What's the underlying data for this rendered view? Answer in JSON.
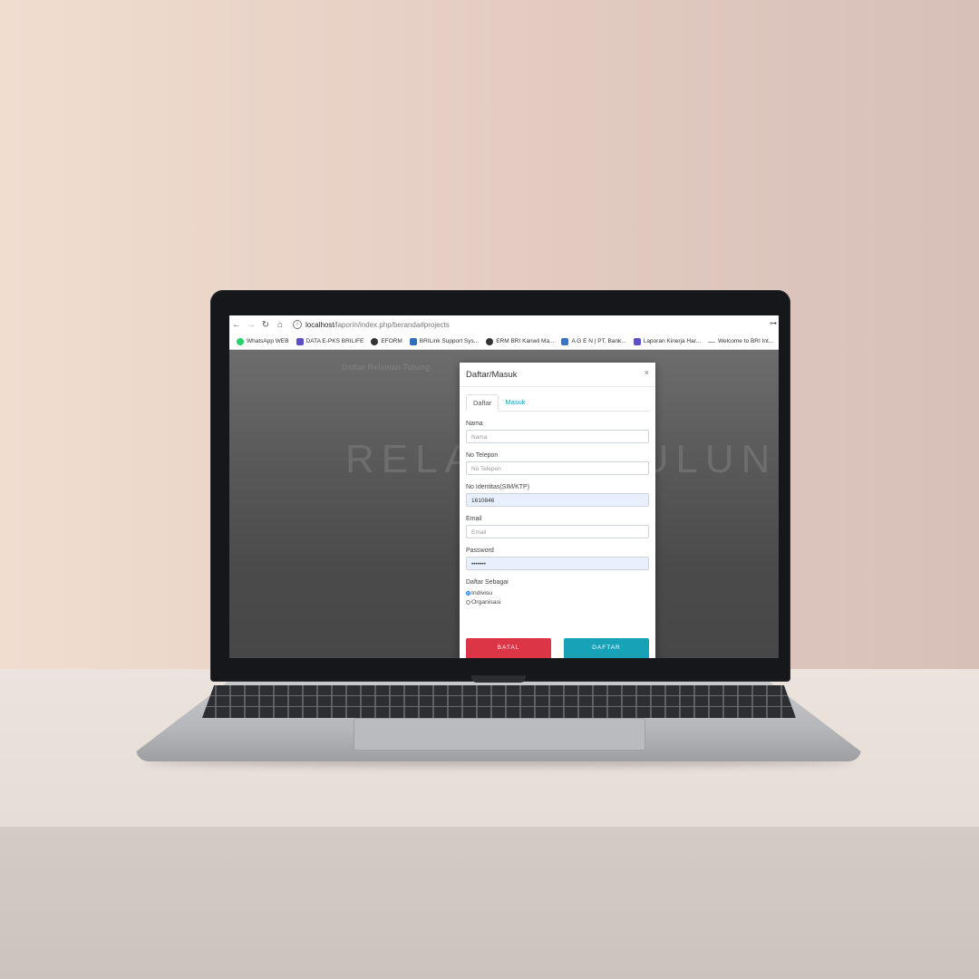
{
  "browser": {
    "url_host": "localhost",
    "url_path": "/laporin/index.php/beranda#projects",
    "bookmarks": [
      {
        "label": "WhatsApp WEB",
        "color": "#25d366"
      },
      {
        "label": "DATA E-PKS BRILIFE",
        "color": "#5c4fc9"
      },
      {
        "label": "EFORM",
        "color": "#333333"
      },
      {
        "label": "BRILink Support Sys...",
        "color": "#2f6fba"
      },
      {
        "label": "ERM BRI Kanwil Ma...",
        "color": "#333333"
      },
      {
        "label": "A G E N | PT. Bank...",
        "color": "#3b73c4"
      },
      {
        "label": "Laporan Kinerja Har...",
        "color": "#5c4fc9"
      },
      {
        "label": "Welcome to BRI Int...",
        "color": "#999999"
      }
    ]
  },
  "page": {
    "brand": "Daftar Relawan Tulung",
    "hero": "RELAWAN TULUNG"
  },
  "modal": {
    "title": "Daftar/Masuk",
    "close": "×",
    "tabs": [
      "Daftar",
      "Masuk"
    ],
    "fields": [
      {
        "label": "Nama",
        "placeholder": "Nama",
        "value": ""
      },
      {
        "label": "No Telepon",
        "placeholder": "No Telepon",
        "value": ""
      },
      {
        "label": "No Identitas(SIM/KTP)",
        "placeholder": "",
        "value": "1610846"
      },
      {
        "label": "Email",
        "placeholder": "Email",
        "value": ""
      },
      {
        "label": "Password",
        "placeholder": "",
        "value": "•••••••"
      }
    ],
    "register_as": {
      "label": "Daftar Sebagai",
      "options": [
        "Indivisu",
        "Organisasi"
      ],
      "selected": "Indivisu"
    },
    "cancel_button": "BATAL",
    "submit_button": "DAFTAR"
  }
}
